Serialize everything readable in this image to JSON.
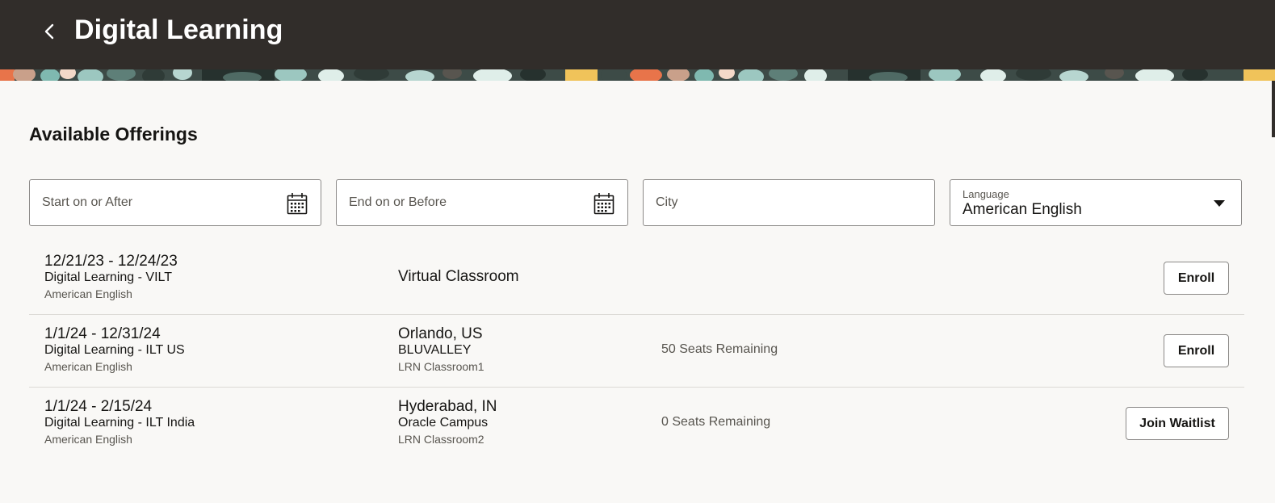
{
  "header": {
    "title": "Digital Learning"
  },
  "section": {
    "title": "Available Offerings"
  },
  "filters": {
    "start_placeholder": "Start on or After",
    "end_placeholder": "End on or Before",
    "city_placeholder": "City",
    "language_label": "Language",
    "language_value": "American English"
  },
  "offerings": [
    {
      "dates": "12/21/23 - 12/24/23",
      "name": "Digital Learning - VILT",
      "language": "American English",
      "location": "Virtual Classroom",
      "facility": "",
      "room": "",
      "seats": "",
      "action": "Enroll"
    },
    {
      "dates": "1/1/24 - 12/31/24",
      "name": "Digital Learning - ILT US",
      "language": "American English",
      "location": "Orlando, US",
      "facility": "BLUVALLEY",
      "room": "LRN Classroom1",
      "seats": "50 Seats Remaining",
      "action": "Enroll"
    },
    {
      "dates": "1/1/24 - 2/15/24",
      "name": "Digital Learning - ILT India",
      "language": "American English",
      "location": "Hyderabad, IN",
      "facility": "Oracle Campus",
      "room": "LRN Classroom2",
      "seats": "0 Seats Remaining",
      "action": "Join Waitlist"
    }
  ],
  "icons": {
    "back": "chevron-left-icon",
    "calendar": "calendar-icon",
    "dropdown": "caret-down-icon"
  },
  "colors": {
    "header_bg": "#312d2a",
    "page_bg": "#f9f8f6",
    "border": "#8c8a88",
    "divider": "#dcdad6"
  }
}
